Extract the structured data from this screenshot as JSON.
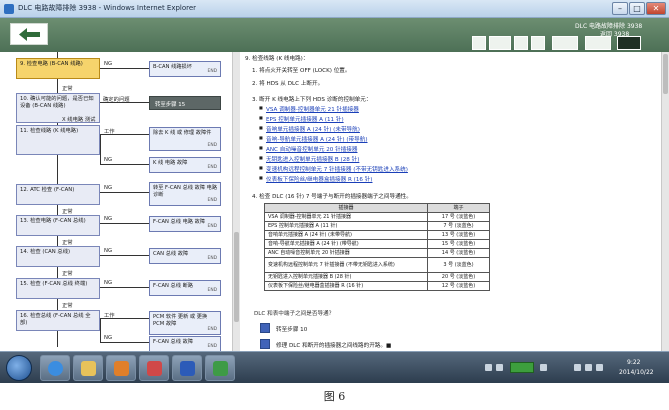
{
  "window": {
    "title": "DLC 电路故障排除 3938 - Windows Internet Explorer",
    "min_label": "–",
    "max_label": "□",
    "close_label": "✕"
  },
  "header": {
    "title": "DLC 电路故障排除 3938",
    "subtitle": "返回 3938"
  },
  "flow": {
    "s1": "9. 检查电路 (B-CAN 线路)",
    "s1_no": "NG",
    "r1": "B-CAN 线路损坏",
    "r1_code": "END",
    "ok1": "正常",
    "s2": "10. 确认可能的问题，是否已知设备 (B-CAN 线路)",
    "s2_mid": "确定的问题",
    "s2_no": "NG",
    "d2": "转至步骤 15",
    "s2_label": "X 线电路 测试",
    "s3": "11. 检查线路 (K 线电路)",
    "s3_work": "工作",
    "r3": "除去 K 线 或 修理 故障件",
    "r3_code": "END",
    "s3_no": "NG",
    "r3b": "K 线 电路 故障",
    "r3b_code": "END",
    "s4": "12. ATC 检查 (F-CAN)",
    "s4_no": "NG",
    "r4": "转至 F-CAN 总线 故障 电路 诊断",
    "r4_code": "END",
    "ok4": "正常",
    "s5": "13. 检查电路 (F-CAN 总线)",
    "s5_no": "NG",
    "r5": "F-CAN 总线 电路 故障",
    "r5_code": "END",
    "ok5": "正常",
    "s6": "14. 检查 (CAN 总线)",
    "s6_no": "NG",
    "r6": "CAN 总线 故障",
    "r6_code": "END",
    "ok6": "正常",
    "s7": "15. 检查 (F-CAN 总线 终端)",
    "s7_no": "NG",
    "r7": "F-CAN 总线 断路",
    "r7_code": "END",
    "ok7": "正常",
    "s8": "16. 检查总线 (F-CAN 总线 全部)",
    "s8_work": "工作",
    "r8": "PCM 软件 更新 或 更换 PCM 故障",
    "r8_code": "END",
    "s8_no": "NG",
    "r8b": "F-CAN 总线 故障",
    "r8b_code": "END"
  },
  "content": {
    "step_head": "9. 检查线路 (K 线电路)：",
    "line1": "1. 将点火开关转至 OFF (LOCK) 位置。",
    "line2": "2. 将 HDS 从 DLC 上断开。",
    "line3": "3. 断开 K 线电路上下列 HDS 诊断的控制单元：",
    "links": [
      "VSA 调制器-控制器单元 21 针插接器",
      "EPS 控制单元插接器 A (11 针)",
      "音响单元插接器 A (24 针) (未带导航)",
      "音响-导航单元插接器 A (24 针) (带导航)",
      "ANC 自动噪音控制单元 20 针插接器",
      "无钥匙进入控制单元插接器 B (28 针)",
      "变速机构远程控制单元 7 针插接器 (不带无钥匙进入系统)",
      "仪表板下保险丝/继电器盒插接器 R (16 针)"
    ],
    "line4": "4. 检查 DLC (16 针) 7 号端子与断开的插接器端子之间导通性。",
    "table": {
      "headers": [
        "插接器",
        "端子"
      ],
      "rows": [
        [
          "VSA 调制器-控制器单元 21 针插接器",
          "17 号 (淡蓝色)"
        ],
        [
          "EPS 控制单元插接器 A (11 针)",
          "7 号 (淡蓝色)"
        ],
        [
          "音响单元插接器 A (24 针) (未带导航)",
          "13 号 (淡蓝色)"
        ],
        [
          "音响-导航单元插接器 A (24 针) (带导航)",
          "15 号 (淡蓝色)"
        ],
        [
          "ANC 自动噪音控制单元 20 针插接器",
          "14 号 (淡蓝色)"
        ],
        [
          "变速机构远程控制单元 7 针插接器 (不带无钥匙进入系统)",
          "3 号 (淡蓝色)"
        ],
        [
          "无钥匙进入控制单元插接器 B (28 针)",
          "20 号 (淡蓝色)"
        ],
        [
          "仪表板下保险丝/继电器盒插接器 R (16 针)",
          "12 号 (淡蓝色)"
        ]
      ]
    },
    "question": "DLC 和表中端子之间是否导通？",
    "answer1": "转至步骤 10",
    "answer2": "修理 DLC 和断开的插接器之间线路的开路。■"
  },
  "taskbar": {
    "time": "9:22",
    "date": "2014/10/22",
    "tray_label": "返回"
  },
  "caption": "图 6"
}
